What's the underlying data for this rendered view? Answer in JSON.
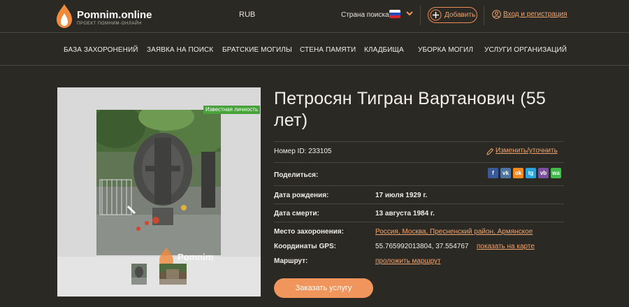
{
  "header": {
    "logo_name": "Pomnim.online",
    "logo_sub": "ПРОЕКТ ПОМНИМ-ОНЛАЙН",
    "currency": "RUB",
    "country_label": "Страна поиска:",
    "country_flag": "russia-flag",
    "add_label": "Добавить",
    "login_label": "Вход и регистрация"
  },
  "nav": {
    "items": [
      "БАЗА ЗАХОРОНЕНИЙ",
      "ЗАЯВКА НА ПОИСК",
      "БРАТСКИЕ МОГИЛЫ",
      "СТЕНА ПАМЯТИ",
      "КЛАДБИЩА",
      "УБОРКА МОГИЛ",
      "УСЛУГИ ОРГАНИЗАЦИЙ"
    ]
  },
  "photo": {
    "tag": "Известная личность",
    "watermark": "Pomnim"
  },
  "person": {
    "name": "Петросян Тигран Вартанович (55 лет)",
    "id_label": "Номер ID: 233105",
    "edit_label": "Изменить/уточнить",
    "share_label": "Поделиться:",
    "share_buttons": [
      "f",
      "vk",
      "ok",
      "tg",
      "vb",
      "wa"
    ],
    "birth_label": "Дата рождения:",
    "birth_value": "17 июля 1929 г.",
    "death_label": "Дата смерти:",
    "death_value": "13 августа 1984 г.",
    "burial_label": "Место захоронения:",
    "burial_value": "Россия, Москва, Пресненский район, Армянское",
    "gps_label": "Координаты GPS:",
    "gps_value": "55.765992013804, 37.554767",
    "gps_map_link": "показать на карте",
    "route_label": "Маршрут:",
    "route_link": "проложить маршрут",
    "order_button": "Заказать услугу"
  },
  "colors": {
    "background": "#2b2924",
    "accent": "#f0955b",
    "link": "#f0a46e",
    "tag_green": "#47a23a"
  }
}
